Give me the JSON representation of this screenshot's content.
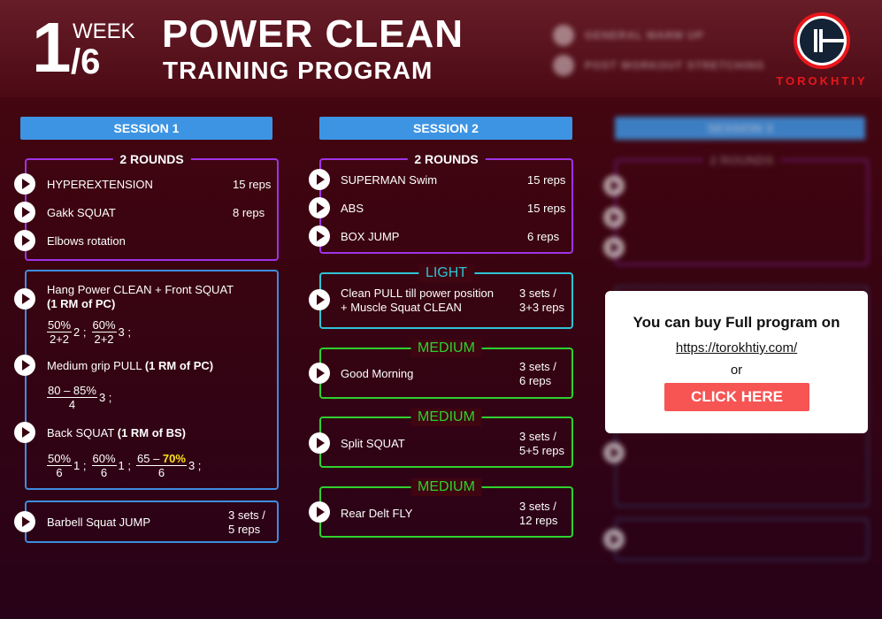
{
  "header": {
    "week_number": "1",
    "week_label": "WEEK",
    "week_total": "/6",
    "title": "POWER CLEAN",
    "subtitle": "TRAINING PROGRAM",
    "blurred_items": [
      "GENERAL WARM UP",
      "POST WORKOUT STRETCHING"
    ],
    "logo_text": "TOROKHTIY"
  },
  "session1": {
    "title": "SESSION 1",
    "block1": {
      "label": "2 ROUNDS",
      "exercises": [
        {
          "name": "HYPEREXTENSION",
          "reps": "15 reps"
        },
        {
          "name": "Gakk SQUAT",
          "reps": "8 reps"
        },
        {
          "name": "Elbows rotation",
          "reps": ""
        }
      ]
    },
    "block2": {
      "ex1": {
        "name": "Hang Power CLEAN + Front SQUAT",
        "note": "(1 RM of PC)",
        "sets": [
          {
            "num": "50%",
            "den": "2+2",
            "tail": "2 ;"
          },
          {
            "num": "60%",
            "den": "2+2",
            "tail": "3 ;"
          }
        ]
      },
      "ex2": {
        "name": "Medium grip PULL",
        "note": "(1 RM of PC)",
        "sets": [
          {
            "num": "80 – 85%",
            "den": "4",
            "tail": "3 ;"
          }
        ]
      },
      "ex3": {
        "name": "Back SQUAT",
        "note": "(1 RM of BS)",
        "sets": [
          {
            "num": "50%",
            "den": "6",
            "tail": "1 ;"
          },
          {
            "num": "60%",
            "den": "6",
            "tail": "1 ;"
          },
          {
            "num_prefix": "65 – ",
            "num_highlight": "70%",
            "den": "6",
            "tail": "3 ;"
          }
        ]
      }
    },
    "block3": {
      "name": "Barbell Squat JUMP",
      "reps_line1": "3 sets /",
      "reps_line2": "5 reps"
    }
  },
  "session2": {
    "title": "SESSION 2",
    "block1": {
      "label": "2 ROUNDS",
      "exercises": [
        {
          "name": "SUPERMAN Swim",
          "reps": "15 reps"
        },
        {
          "name": "ABS",
          "reps": "15 reps"
        },
        {
          "name": "BOX JUMP",
          "reps": "6 reps"
        }
      ]
    },
    "blocks": [
      {
        "label": "LIGHT",
        "name_line1": "Clean PULL till power position",
        "name_line2": "+ Muscle Squat CLEAN",
        "reps_line1": "3 sets /",
        "reps_line2": "3+3 reps"
      },
      {
        "label": "MEDIUM",
        "name_line1": "Good Morning",
        "name_line2": "",
        "reps_line1": "3 sets /",
        "reps_line2": "6 reps"
      },
      {
        "label": "MEDIUM",
        "name_line1": "Split SQUAT",
        "name_line2": "",
        "reps_line1": "3 sets /",
        "reps_line2": "5+5 reps"
      },
      {
        "label": "MEDIUM",
        "name_line1": "Rear Delt FLY",
        "name_line2": "",
        "reps_line1": "3 sets /",
        "reps_line2": "12 reps"
      }
    ]
  },
  "session3": {
    "title": "SESSION 3",
    "label": "2 ROUNDS"
  },
  "popup": {
    "title": "You can buy Full program on",
    "link": "https://torokhtiy.com/",
    "or": "or",
    "button": "CLICK HERE"
  },
  "colors": {
    "session_header": "#3d94e3",
    "rounds_border": "#a033e6",
    "light_border": "#2fc3d6",
    "medium_border": "#2fd12f",
    "block_border": "#3e8ddf",
    "highlight": "#ffe11a",
    "cta": "#f75454",
    "logo_red": "#e8161b"
  }
}
